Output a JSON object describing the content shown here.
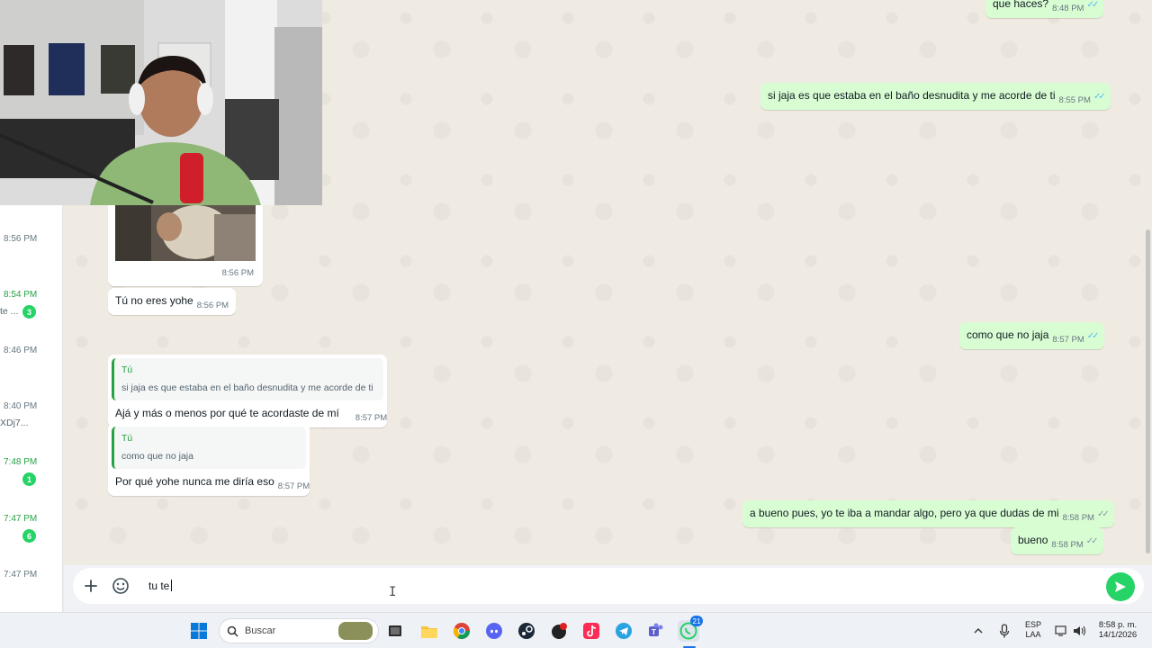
{
  "sidebar": {
    "rows": [
      {
        "time": "8:56 PM",
        "green": false,
        "snippet": "",
        "badge": ""
      },
      {
        "time": "8:54 PM",
        "green": true,
        "snippet": "te ...",
        "badge": "3"
      },
      {
        "time": "8:46 PM",
        "green": false,
        "snippet": "",
        "badge": ""
      },
      {
        "time": "8:40 PM",
        "green": false,
        "snippet": "XDj7...",
        "badge": ""
      },
      {
        "time": "7:48 PM",
        "green": true,
        "snippet": "",
        "badge": "1"
      },
      {
        "time": "7:47 PM",
        "green": true,
        "snippet": "",
        "badge": "6"
      },
      {
        "time": "7:47 PM",
        "green": false,
        "snippet": "",
        "badge": ""
      }
    ]
  },
  "messages": {
    "m0": {
      "text": "que haces?",
      "time": "8:48 PM"
    },
    "m1": {
      "text": "si jaja es que estaba en el baño desnudita y me acorde de ti",
      "time": "8:55 PM"
    },
    "m2": {
      "time": "8:56 PM"
    },
    "m3": {
      "text": "Tú no eres yohe",
      "time": "8:56 PM"
    },
    "m4": {
      "text": "como que no jaja",
      "time": "8:57 PM"
    },
    "m5": {
      "quote_author": "Tú",
      "quote_text": "si jaja es que estaba en el baño desnudita y me acorde de ti",
      "text": "Ajá y más o menos por qué te acordaste de mí",
      "time": "8:57 PM"
    },
    "m6": {
      "quote_author": "Tú",
      "quote_text": "como que no jaja",
      "text": "Por qué yohe nunca me diría eso",
      "time": "8:57 PM"
    },
    "m7": {
      "text": "a bueno pues, yo te iba a mandar algo, pero ya que dudas de mi",
      "time": "8:58 PM"
    },
    "m8": {
      "text": "bueno",
      "time": "8:58 PM"
    }
  },
  "composer": {
    "value": "tu te"
  },
  "taskbar": {
    "search_label": "Buscar",
    "whatsapp_badge": "21",
    "lang_line1": "ESP",
    "lang_line2": "LAA",
    "clock_time": "8:58 p. m.",
    "clock_date": "14/1/2026"
  },
  "colors": {
    "accent": "#25d366",
    "outgoing": "#d9fdd3",
    "incoming": "#ffffff",
    "read_ticks": "#53bdeb"
  }
}
